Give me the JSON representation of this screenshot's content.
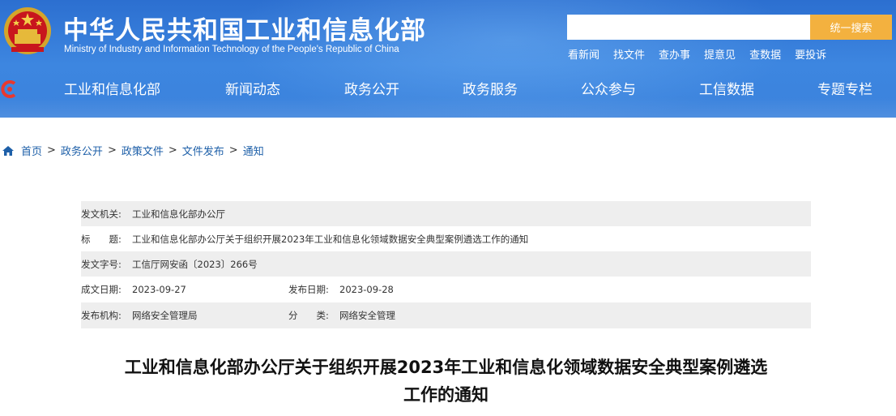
{
  "header": {
    "title": "中华人民共和国工业和信息化部",
    "subtitle": "Ministry of Industry and Information Technology of the People's Republic of China",
    "search": {
      "placeholder": "",
      "button_label": "统一搜索"
    },
    "quick_links": [
      "看新闻",
      "找文件",
      "查办事",
      "提意见",
      "查数据",
      "要投诉"
    ],
    "colors": {
      "header_blue": "#3b82dc",
      "search_button": "#f3b13f"
    }
  },
  "nav": {
    "items": [
      "工业和信息化部",
      "新闻动态",
      "政务公开",
      "政务服务",
      "公众参与",
      "工信数据",
      "专题专栏"
    ]
  },
  "breadcrumb": {
    "items": [
      "首页",
      "政务公开",
      "政策文件",
      "文件发布",
      "通知"
    ],
    "separator": ">"
  },
  "info": {
    "issuer_label": "发文机关:",
    "issuer": "工业和信息化部办公厅",
    "title_label": "标　　题:",
    "title": "工业和信息化部办公厅关于组织开展2023年工业和信息化领域数据安全典型案例遴选工作的通知",
    "doc_no_label": "发文字号:",
    "doc_no": "工信厅网安函〔2023〕266号",
    "written_label": "成文日期:",
    "written_date": "2023-09-27",
    "published_label": "发布日期:",
    "published_date": "2023-09-28",
    "agency_label": "发布机构:",
    "agency": "网络安全管理局",
    "category_label": "分　　类:",
    "category": "网络安全管理"
  },
  "article": {
    "title_line1": "工业和信息化部办公厅关于组织开展2023年工业和信息化领域数据安全典型案例遴选",
    "title_line2": "工作的通知"
  }
}
